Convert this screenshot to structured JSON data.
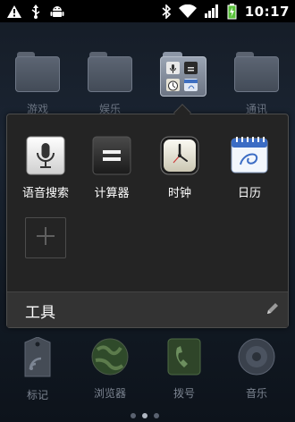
{
  "status_bar": {
    "time": "10:17",
    "left_icons": [
      "warning-icon",
      "usb-icon",
      "android-debug-icon"
    ],
    "right_icons": [
      "bluetooth-icon",
      "wifi-icon",
      "signal-icon",
      "battery-charging-icon"
    ]
  },
  "background_folders": [
    {
      "label": "游戏"
    },
    {
      "label": "娱乐"
    },
    {
      "label": "通讯"
    }
  ],
  "folder_panel": {
    "name": "工具",
    "apps": [
      {
        "label": "语音搜索",
        "icon": "microphone-icon"
      },
      {
        "label": "计算器",
        "icon": "calculator-icon"
      },
      {
        "label": "时钟",
        "icon": "clock-icon"
      },
      {
        "label": "日历",
        "icon": "calendar-icon"
      }
    ],
    "add_slot_icon": "plus-icon",
    "edit_icon": "pencil-icon"
  },
  "dock": [
    {
      "label": "标记",
      "icon": "tag-icon"
    },
    {
      "label": "浏览器",
      "icon": "globe-icon"
    },
    {
      "label": "拨号",
      "icon": "phone-icon"
    },
    {
      "label": "音乐",
      "icon": "music-icon"
    }
  ],
  "page_indicator": {
    "count": 3,
    "active_index": 1
  },
  "colors": {
    "panel_bg": "#242424",
    "footer_bg": "#333333",
    "battery_green": "#59c13a"
  }
}
